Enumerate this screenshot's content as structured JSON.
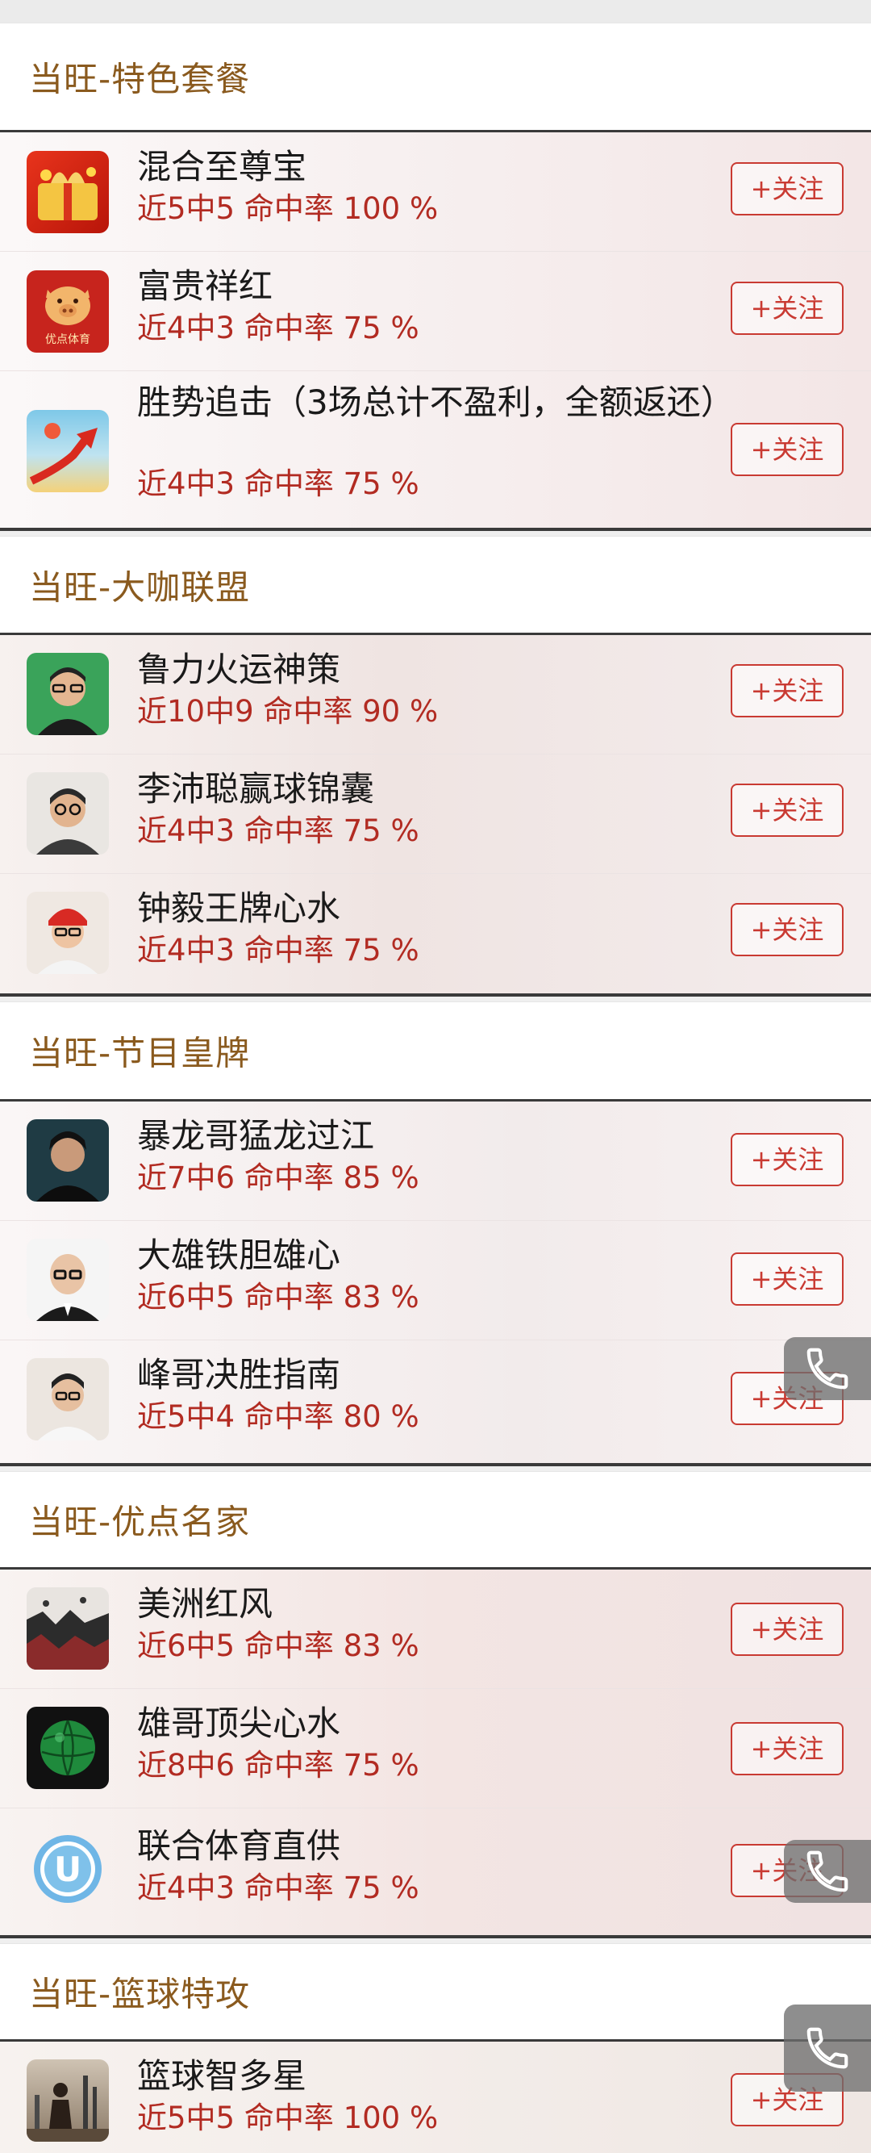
{
  "sections": [
    {
      "title": "当旺-特色套餐",
      "items": [
        {
          "name": "混合至尊宝",
          "stats": "近5中5 命中率 100 %",
          "follow": "+关注",
          "icon": "gift-money-icon"
        },
        {
          "name": "富贵祥红",
          "stats": "近4中3 命中率 75 %",
          "follow": "+关注",
          "icon": "golden-pig-logo",
          "logo_caption": "优点体育"
        },
        {
          "name": "胜势追击（3场总计不盈利，全额返还）",
          "stats": "近4中3 命中率 75 %",
          "follow": "+关注",
          "icon": "rising-arrow-icon"
        }
      ]
    },
    {
      "title": "当旺-大咖联盟",
      "items": [
        {
          "name": "鲁力火运神策",
          "stats": "近10中9 命中率 90 %",
          "follow": "+关注",
          "icon": "avatar-photo"
        },
        {
          "name": "李沛聪赢球锦囊",
          "stats": "近4中3 命中率 75 %",
          "follow": "+关注",
          "icon": "avatar-photo"
        },
        {
          "name": "钟毅王牌心水",
          "stats": "近4中3 命中率 75 %",
          "follow": "+关注",
          "icon": "avatar-photo"
        }
      ]
    },
    {
      "title": "当旺-节目皇牌",
      "items": [
        {
          "name": "暴龙哥猛龙过江",
          "stats": "近7中6 命中率 85 %",
          "follow": "+关注",
          "icon": "avatar-photo"
        },
        {
          "name": "大雄铁胆雄心",
          "stats": "近6中5 命中率 83 %",
          "follow": "+关注",
          "icon": "avatar-photo"
        },
        {
          "name": "峰哥决胜指南",
          "stats": "近5中4 命中率 80 %",
          "follow": "+关注",
          "icon": "avatar-photo"
        }
      ]
    },
    {
      "title": "当旺-优点名家",
      "items": [
        {
          "name": "美洲红风",
          "stats": "近6中5 命中率 83 %",
          "follow": "+关注",
          "icon": "crowd-photo"
        },
        {
          "name": "雄哥顶尖心水",
          "stats": "近8中6 命中率 75 %",
          "follow": "+关注",
          "icon": "green-ball-icon"
        },
        {
          "name": "联合体育直供",
          "stats": "近4中3 命中率 75 %",
          "follow": "+关注",
          "icon": "letter-u-icon",
          "icon_letter": "U"
        }
      ]
    },
    {
      "title": "当旺-篮球特攻",
      "items": [
        {
          "name": "篮球智多星",
          "stats": "近5中5 命中率 100 %",
          "follow": "+关注",
          "icon": "basketball-player-photo"
        }
      ]
    }
  ],
  "colors": {
    "section_title": "#8a5a1e",
    "stats_red": "#b22b22",
    "follow_red": "#c93a32"
  },
  "floating_icon": "phone-icon"
}
